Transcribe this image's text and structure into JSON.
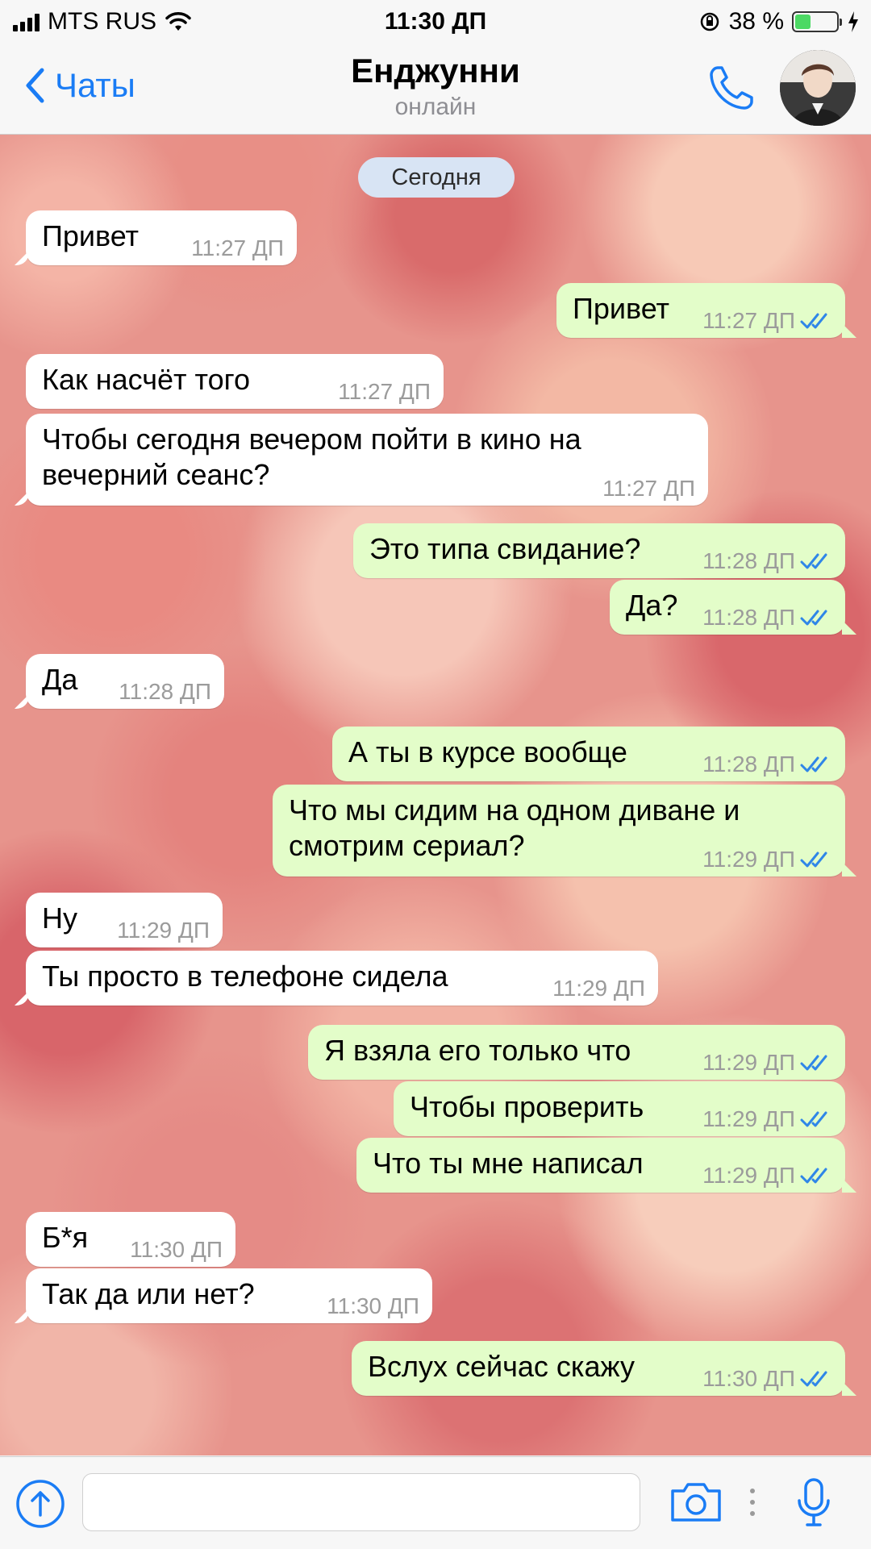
{
  "status_bar": {
    "carrier": "MTS RUS",
    "time": "11:30 ДП",
    "battery_text": "38 %",
    "battery_level": 0.38
  },
  "header": {
    "back_label": "Чаты",
    "title": "Енджунни",
    "status": "онлайн"
  },
  "chat": {
    "date_label": "Сегодня",
    "messages": [
      {
        "dir": "in",
        "text": "Привет",
        "time": "11:27 ДП"
      },
      {
        "dir": "out",
        "text": "Привет",
        "time": "11:27 ДП"
      },
      {
        "dir": "in",
        "text": "Как насчёт того",
        "time": "11:27 ДП"
      },
      {
        "dir": "in",
        "text": "Чтобы сегодня вечером пойти в кино на вечерний сеанс?",
        "time": "11:27 ДП"
      },
      {
        "dir": "out",
        "text": "Это типа свидание?",
        "time": "11:28 ДП"
      },
      {
        "dir": "out",
        "text": "Да?",
        "time": "11:28 ДП"
      },
      {
        "dir": "in",
        "text": "Да",
        "time": "11:28 ДП"
      },
      {
        "dir": "out",
        "text": "А ты в курсе вообще",
        "time": "11:28 ДП"
      },
      {
        "dir": "out",
        "text": "Что мы сидим на одном диване и смотрим сериал?",
        "time": "11:29 ДП"
      },
      {
        "dir": "in",
        "text": "Ну",
        "time": "11:29 ДП"
      },
      {
        "dir": "in",
        "text": "Ты просто в телефоне сидела",
        "time": "11:29 ДП"
      },
      {
        "dir": "out",
        "text": "Я взяла его только что",
        "time": "11:29 ДП"
      },
      {
        "dir": "out",
        "text": "Чтобы проверить",
        "time": "11:29 ДП"
      },
      {
        "dir": "out",
        "text": "Что ты мне написал",
        "time": "11:29 ДП"
      },
      {
        "dir": "in",
        "text": "Б*я",
        "time": "11:30 ДП"
      },
      {
        "dir": "in",
        "text": "Так да или нет?",
        "time": "11:30 ДП"
      },
      {
        "dir": "out",
        "text": "Вслух сейчас скажу",
        "time": "11:30 ДП"
      }
    ]
  },
  "input_bar": {
    "message_value": "",
    "icons": [
      "attach-arrow-icon",
      "camera-icon",
      "more-dots-icon",
      "microphone-icon"
    ]
  },
  "colors": {
    "accent": "#1a7cf5",
    "outgoing_bubble": "#e3fdc9",
    "incoming_bubble": "#ffffff",
    "date_pill": "#d8e4f4",
    "read_check": "#2f86e8"
  }
}
